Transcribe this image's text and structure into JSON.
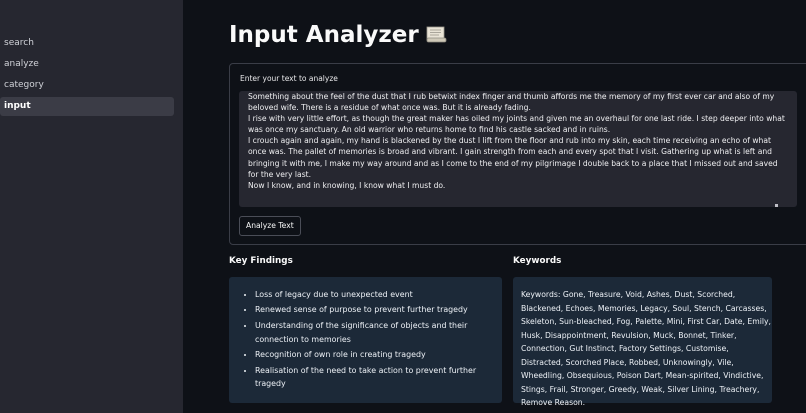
{
  "sidebar": {
    "items": [
      {
        "label": "search"
      },
      {
        "label": "analyze"
      },
      {
        "label": "category"
      },
      {
        "label": "input"
      }
    ],
    "active": "input"
  },
  "page": {
    "title": "Input Analyzer",
    "title_icon": "scroll-icon"
  },
  "form": {
    "label": "Enter your text to analyze",
    "text": "Something about the feel of the dust that I rub betwixt index finger and thumb affords me the memory of my first ever car and also of my beloved wife. There is a residue of what once was. But it is already fading.\nI rise with very little effort, as though the great maker has oiled my joints and given me an overhaul for one last ride. I step deeper into what was once my sanctuary. An old warrior who returns home to find his castle sacked and in ruins.\nI crouch again and again, my hand is blackened by the dust I lift from the floor and rub into my skin, each time receiving an echo of what once was. The pallet of memories is broad and vibrant. I gain strength from each and every spot that I visit. Gathering up what is left and bringing it with me, I make my way around and as I come to the end of my pilgrimage I double back to a place that I missed out and saved for the very last.\nNow I know, and in knowing, I know what I must do.",
    "button_label": "Analyze Text"
  },
  "findings": {
    "heading": "Key Findings",
    "items": [
      "Loss of legacy due to unexpected event",
      "Renewed sense of purpose to prevent further tragedy",
      "Understanding of the significance of objects and their connection to memories",
      "Recognition of own role in creating tragedy",
      "Realisation of the need to take action to prevent further tragedy"
    ]
  },
  "keywords": {
    "heading": "Keywords",
    "text": "Keywords: Gone, Treasure, Void, Ashes, Dust, Scorched, Blackened, Echoes, Memories, Legacy, Soul, Stench, Carcasses, Skeleton, Sun-bleached, Fog, Palette, Mini, First Car, Date, Emily, Husk, Disappointment, Revulsion, Muck, Bonnet, Tinker, Connection, Gut Instinct, Factory Settings, Customise, Distracted, Scorched Place, Robbed, Unknowingly, Vile, Wheedling, Obsequious, Poison Dart, Mean-spirited, Vindictive, Stings, Frail, Stronger, Greedy, Weak, Silver Lining, Treachery, Remove Reason."
  },
  "colors": {
    "background": "#0e1117",
    "sidebar": "#262730",
    "textarea": "#262730",
    "result_box": "#1c2938"
  }
}
